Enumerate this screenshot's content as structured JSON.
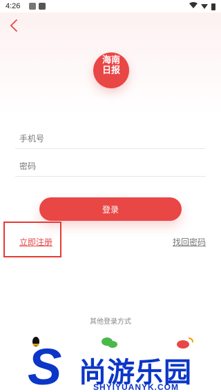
{
  "status_bar": {
    "time": "4:26",
    "icons": [
      "notification-icon",
      "app-icon",
      "wifi-icon",
      "signal-icon",
      "battery-icon"
    ]
  },
  "header": {
    "back_icon": "back-chevron-icon",
    "logo_text": [
      "海南",
      "日报"
    ]
  },
  "form": {
    "phone_placeholder": "手机号",
    "password_placeholder": "密码",
    "login_label": "登录",
    "register_label": "立即注册",
    "forgot_label": "找回密码"
  },
  "social": {
    "title": "其他登录方式",
    "icons": [
      "qq-icon",
      "wechat-icon",
      "weibo-icon"
    ]
  },
  "watermark": {
    "brand": "尚游乐园",
    "url": "SHYIYUANYK.COM"
  },
  "colors": {
    "accent": "#e94646",
    "watermark": "#0b36c8"
  }
}
